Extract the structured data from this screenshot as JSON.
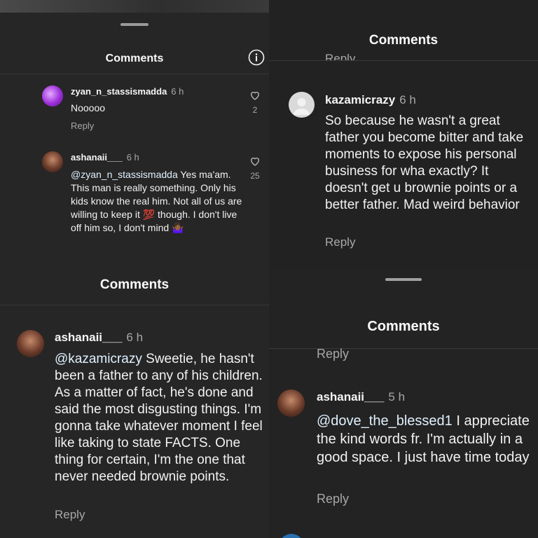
{
  "panel_a": {
    "title": "Comments",
    "comments": [
      {
        "user": "zyan_n_stassismadda",
        "time": "6 h",
        "text": "Nooooo",
        "reply": "Reply",
        "likes": "2"
      },
      {
        "user": "ashanaii___",
        "time": "6 h",
        "mention": "@zyan_n_stassismadda",
        "text": " Yes ma'am. This man is really something. Only his kids know the real him. Not all of us are willing to keep it 💯 though. I don't live off him so, I don't mind 🤷🏾‍♀️",
        "reply": "Reply",
        "likes": "25"
      }
    ]
  },
  "panel_b": {
    "title": "Comments",
    "prev_reply": "Reply",
    "comment": {
      "user": "kazamicrazy",
      "time": "6 h",
      "text": "So because he wasn't a great father you become bitter and take moments to expose his personal business for wha exactly? It doesn't get u brownie points or a better father. Mad weird behavior",
      "reply": "Reply"
    }
  },
  "panel_c": {
    "title": "Comments",
    "comment": {
      "user": "ashanaii___",
      "time": "6 h",
      "mention": "@kazamicrazy",
      "text": " Sweetie, he hasn't been a father to any of his children. As a matter of fact, he's done and said the most disgusting things. I'm gonna take whatever moment I feel like taking to state FACTS. One thing for certain, I'm the one that never needed brownie points.",
      "reply": "Reply"
    }
  },
  "panel_d": {
    "title": "Comments",
    "prev_reply": "Reply",
    "comment": {
      "user": "ashanaii___",
      "time": "5 h",
      "mention": "@dove_the_blessed1",
      "text": " I appreciate the kind words fr. I'm actually in a good space. I just have time today",
      "reply": "Reply"
    }
  },
  "colors": {
    "background": "#262626",
    "mention": "#e0f1ff",
    "muted": "#a8a8a8"
  },
  "icons": [
    "info-icon",
    "heart-outline-icon",
    "default-avatar-icon"
  ]
}
